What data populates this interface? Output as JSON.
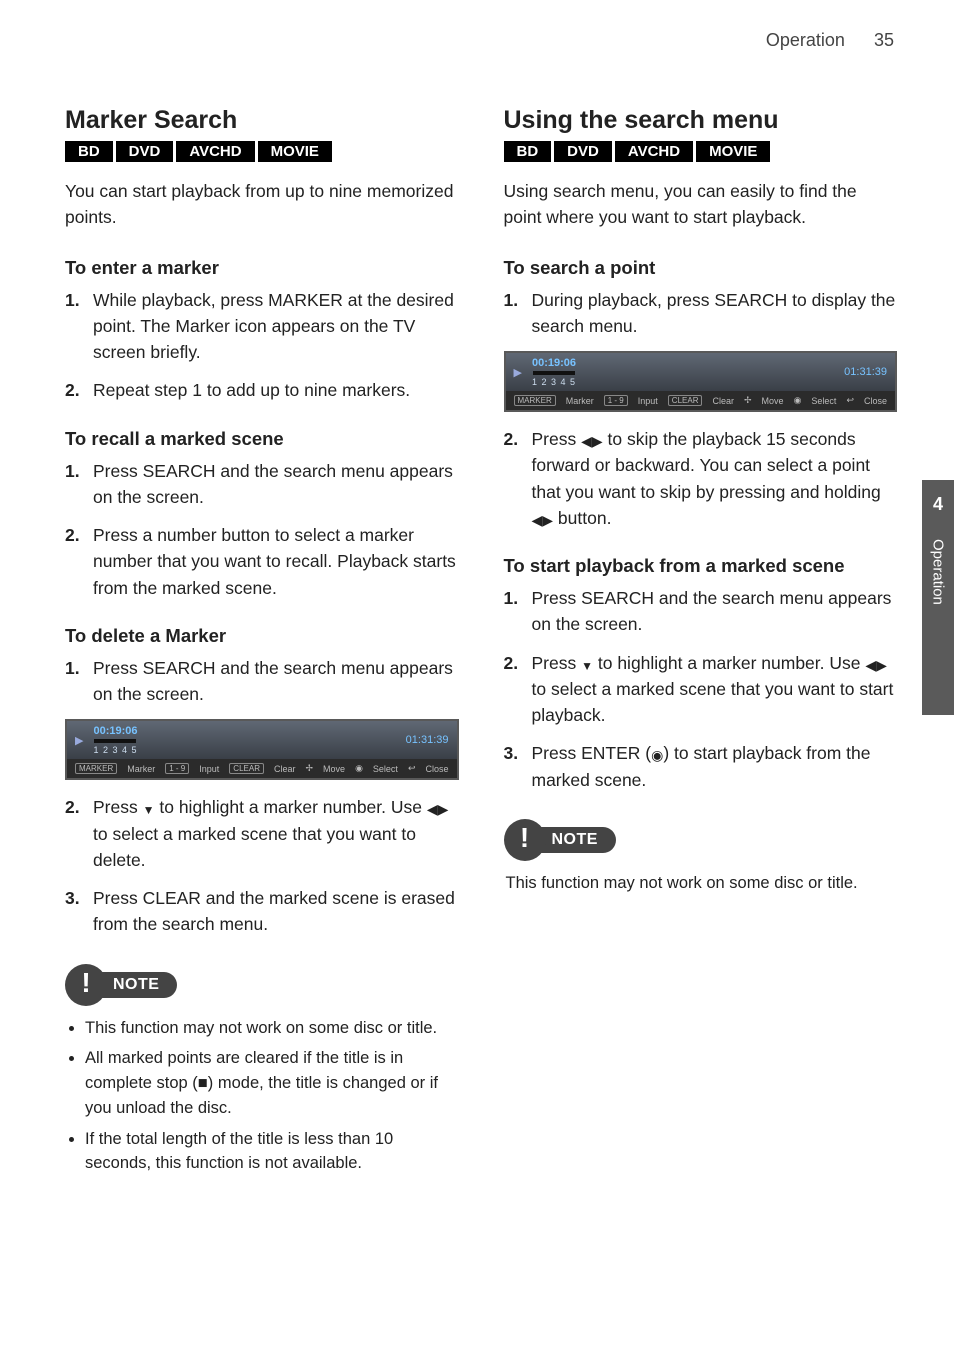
{
  "header": {
    "section": "Operation",
    "page": "35"
  },
  "side_tab": {
    "number": "4",
    "name": "Operation"
  },
  "formats": [
    "BD",
    "DVD",
    "AVCHD",
    "MOVIE"
  ],
  "osd": {
    "current_time": "00:19:06",
    "total_time": "01:31:39",
    "markers_label": "1 2 3 4 5",
    "hints": {
      "marker_btn": "MARKER",
      "marker_lbl": "Marker",
      "input_btn": "1 - 9",
      "input_lbl": "Input",
      "clear_btn": "CLEAR",
      "clear_lbl": "Clear",
      "move_lbl": "Move",
      "select_lbl": "Select",
      "close_lbl": "Close"
    }
  },
  "left": {
    "title": "Marker Search",
    "lead": "You can start playback from up to nine memorized points.",
    "h_enter": "To enter a marker",
    "enter_steps": [
      "While playback, press MARKER at the desired point. The Marker icon appears on the TV screen briefly.",
      "Repeat step 1 to add up to nine markers."
    ],
    "h_recall": "To recall a marked scene",
    "recall_steps": [
      "Press SEARCH and the search menu appears on the screen.",
      "Press a number button to select a marker number that you want to recall. Playback starts from the marked scene."
    ],
    "h_delete": "To delete a Marker",
    "delete_steps": {
      "s1": "Press SEARCH and the search menu appears on the screen.",
      "s2a": "Press ",
      "s2b": " to highlight a marker number. Use ",
      "s2c": " to select a marked scene that you want to delete.",
      "s3": "Press CLEAR and the marked scene is erased from the search menu."
    },
    "note_label": "NOTE",
    "notes": [
      "This function may not work on some disc or title.",
      "All marked points are cleared if the title is in complete stop (■) mode, the title is changed or if you unload the disc.",
      "If the total length of the title is less than 10 seconds, this function is not available."
    ]
  },
  "right": {
    "title": "Using the search menu",
    "lead": "Using search menu, you can easily to find the point where you want to start playback.",
    "h_search": "To search a point",
    "search_steps": {
      "s1": "During playback, press SEARCH to display the search menu.",
      "s2a": "Press ",
      "s2b": " to skip the playback 15 seconds forward or backward. You can select a point that you want to skip by pressing and holding ",
      "s2c": " button."
    },
    "h_start": "To start playback from a marked scene",
    "start_steps": {
      "s1": "Press SEARCH and the search menu appears on the screen.",
      "s2a": "Press ",
      "s2b": " to highlight a marker number. Use ",
      "s2c": " to select a marked scene that you want to start playback.",
      "s3a": "Press ENTER (",
      "s3b": ") to start playback from the marked scene."
    },
    "note_label": "NOTE",
    "note_single": "This function may not work on some disc or title."
  }
}
